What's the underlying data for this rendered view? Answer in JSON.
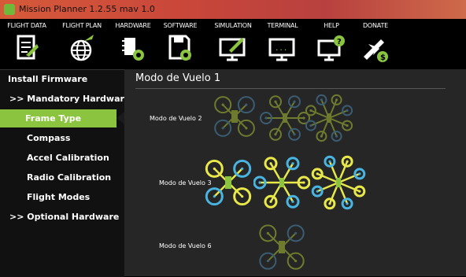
{
  "window": {
    "title": "Mission Planner 1.2.55 mav 1.0"
  },
  "menu": [
    {
      "label": "FLIGHT DATA",
      "icon": "flight-data-icon"
    },
    {
      "label": "FLIGHT PLAN",
      "icon": "globe-icon"
    },
    {
      "label": "HARDWARE",
      "icon": "hardware-icon"
    },
    {
      "label": "SOFTWARE",
      "icon": "floppy-gear-icon"
    },
    {
      "label": "SIMULATION",
      "icon": "monitor-plane-icon"
    },
    {
      "label": "TERMINAL",
      "icon": "terminal-icon"
    },
    {
      "label": "HELP",
      "icon": "help-monitor-icon"
    },
    {
      "label": "DONATE",
      "icon": "donate-plane-icon"
    }
  ],
  "sidebar": {
    "items": [
      {
        "label": "Install Firmware"
      },
      {
        "label": ">> Mandatory Hardware"
      },
      {
        "label": "Frame Type",
        "active": true
      },
      {
        "label": "Compass"
      },
      {
        "label": "Accel Calibration"
      },
      {
        "label": "Radio Calibration"
      },
      {
        "label": "Flight Modes"
      },
      {
        "label": ">> Optional Hardware"
      }
    ]
  },
  "content": {
    "title": "Modo de Vuelo 1",
    "rows": [
      {
        "label": "Modo de Vuelo 2",
        "frames": [
          "quad-x",
          "hexa-x",
          "octo-x"
        ],
        "highlighted": false
      },
      {
        "label": "Modo de Vuelo 3",
        "frames": [
          "quad-x",
          "hexa-x",
          "octo-x"
        ],
        "highlighted": true
      },
      {
        "label": "Modo de Vuelo 6",
        "frames": [
          "quad-x"
        ],
        "highlighted": false
      }
    ]
  },
  "colors": {
    "accent": "#8bc43f",
    "titlebar": "#c9463a",
    "yellow_rotor": "#e8e84a",
    "blue_rotor": "#49b4e0",
    "dim_yellow": "#6e7a2e",
    "dim_blue": "#3a5d73"
  }
}
